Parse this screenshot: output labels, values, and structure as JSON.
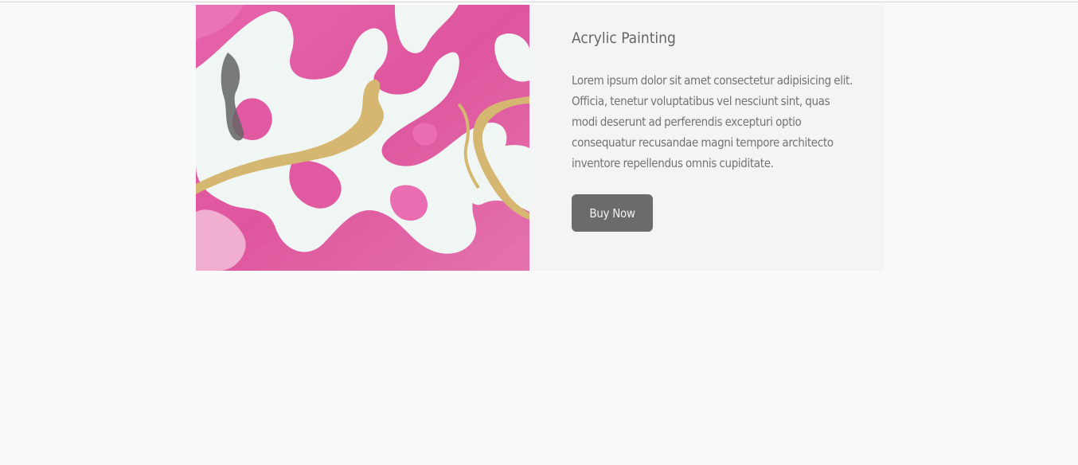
{
  "product": {
    "title": "Acrylic Painting",
    "description": "Lorem ipsum dolor sit amet consectetur adipisicing elit. Officia, tenetur voluptatibus vel nesciunt sint, quas modi deserunt ad perferendis excepturi optio consequatur recusandae magni tempore architecto inventore repellendus omnis cupiditate.",
    "buy_label": "Buy Now",
    "image_icon": "marble-painting-image"
  },
  "colors": {
    "page_background": "#fafafa",
    "card_background": "#f4f4f4",
    "text": "#737373",
    "button_background": "#6b6b6b",
    "button_text": "#f2f2f2",
    "paint_pink": "#e04f9c",
    "paint_white": "#eef6f3",
    "paint_gold": "#d4b36a",
    "paint_dark": "#5a5a5a"
  }
}
